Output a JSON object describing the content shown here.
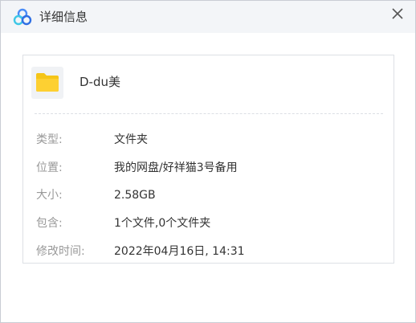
{
  "window": {
    "title": "详细信息",
    "app_icon": "baidu-netdisk-cloud-icon",
    "close_icon": "close-icon"
  },
  "file": {
    "name": "D-du美",
    "icon": "folder-icon",
    "folder_color": "#FDD032"
  },
  "details": [
    {
      "label": "类型:",
      "value": "文件夹"
    },
    {
      "label": "位置:",
      "value": "我的网盘/好祥猫3号备用"
    },
    {
      "label": "大小:",
      "value": "2.58GB"
    },
    {
      "label": "包含:",
      "value": "1个文件,0个文件夹"
    },
    {
      "label": "修改时间:",
      "value": "2022年04月16日, 14:31"
    }
  ]
}
